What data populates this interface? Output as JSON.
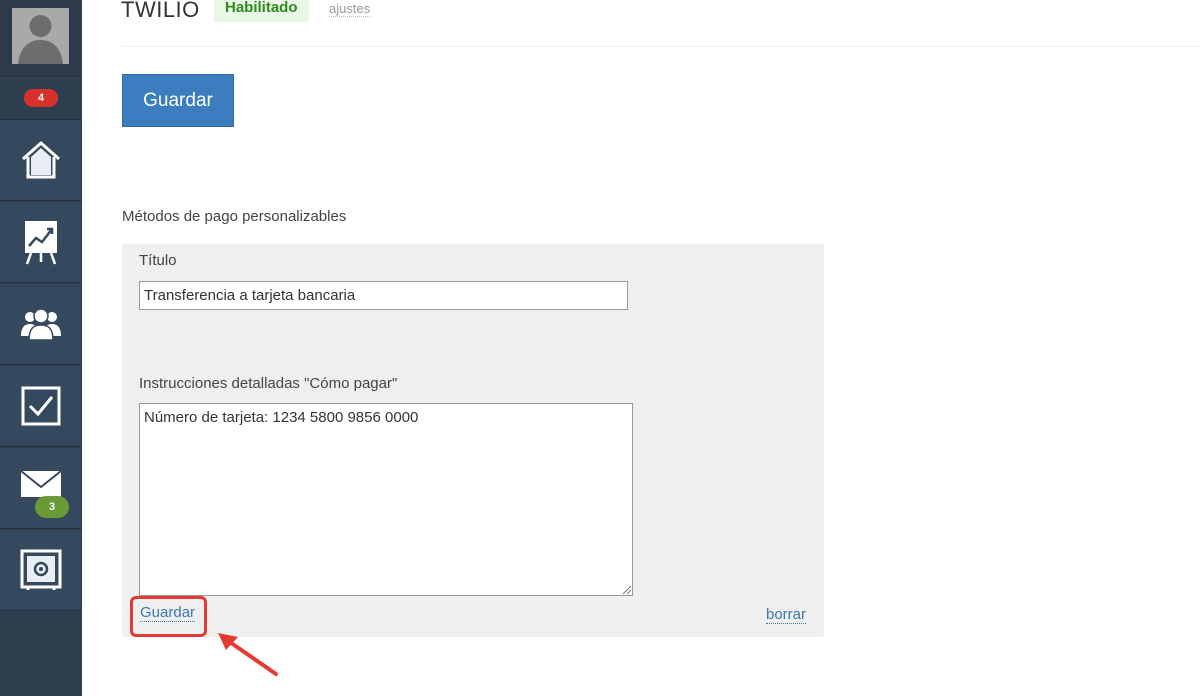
{
  "sidebar": {
    "notifications_badge": "4",
    "mail_badge": "3",
    "items": [
      {
        "icon": "home-icon"
      },
      {
        "icon": "chart-board-icon"
      },
      {
        "icon": "users-icon"
      },
      {
        "icon": "checkbox-icon"
      },
      {
        "icon": "mail-icon"
      },
      {
        "icon": "safe-icon"
      }
    ]
  },
  "header": {
    "title": "TWILIO",
    "status": "Habilitado",
    "settings_link": "ajustes"
  },
  "toolbar": {
    "save_label": "Guardar"
  },
  "payment_methods": {
    "section_title": "Métodos de pago personalizables",
    "title_label": "Título",
    "title_value": "Transferencia a tarjeta bancaria",
    "instructions_label": "Instrucciones detalladas \"Cómo pagar\"",
    "instructions_value": "Número de tarjeta: 1234 5800 9856 0000",
    "save_link": "Guardar",
    "delete_link": "borrar"
  },
  "colors": {
    "sidebar_bg": "#34495e",
    "primary_button": "#3b7dbf",
    "link": "#3a78b5",
    "status_green": "#2e8b1f",
    "badge_red": "#d8302c",
    "badge_green": "#6a9a35",
    "annotation_red": "#e53935"
  }
}
